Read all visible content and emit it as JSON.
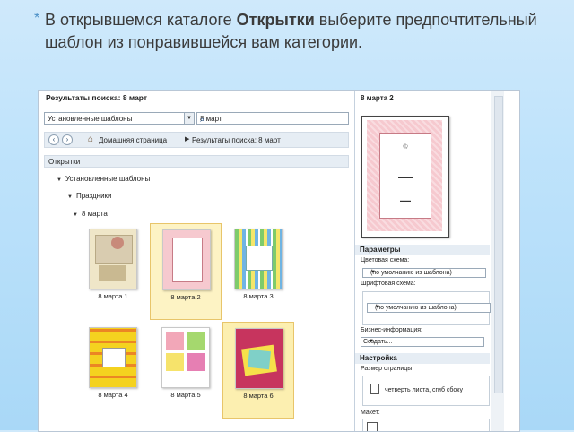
{
  "slide": {
    "bullet_part1": "В открывшемся каталоге ",
    "bullet_bold": "Открытки",
    "bullet_part2": " выберите предпочтительный шаблон из понравившейся вам категории."
  },
  "dialog": {
    "results_title": "Результаты поиска: 8 март",
    "templates_combo_value": "Установленные шаблоны",
    "search_value": "8 март",
    "breadcrumb_home": "Домашняя страница",
    "breadcrumb_results": "Результаты поиска: 8 март",
    "category_bar": "Открытки",
    "tree": [
      "Установленные шаблоны",
      "Праздники",
      "8 марта"
    ],
    "templates": [
      {
        "caption": "8 марта 1"
      },
      {
        "caption": "8 марта 2"
      },
      {
        "caption": "8 марта 3"
      },
      {
        "caption": "8 марта 4"
      },
      {
        "caption": "8 марта 5"
      },
      {
        "caption": "8 марта 6"
      }
    ],
    "right_panel": {
      "title": "8 марта 2",
      "params_header": "Параметры",
      "color_scheme_label": "Цветовая схема:",
      "color_scheme_value": "(по умолчанию из шаблона)",
      "font_scheme_label": "Шрифтовая схема:",
      "font_scheme_value": "(по умолчанию из шаблона)",
      "business_label": "Бизнес-информация:",
      "business_value": "Создать...",
      "settings_header": "Настройка",
      "page_size_label": "Размер страницы:",
      "page_size_value": "четверть листа, сгиб сбоку",
      "layout_label": "Макет:"
    }
  },
  "colors": {
    "accent": "#4b8fc6",
    "selected_bg": "#fdf3c4",
    "pink_card": "#f6c9cf"
  }
}
